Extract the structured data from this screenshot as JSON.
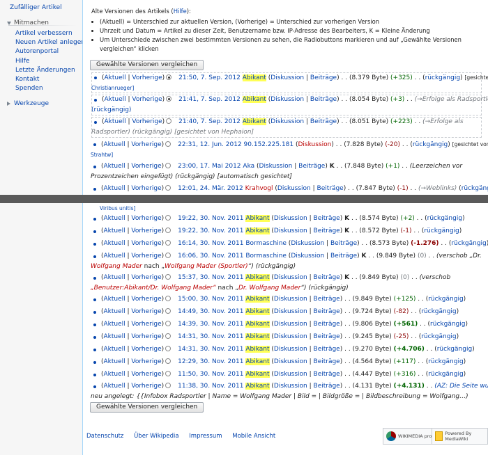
{
  "sidebar": {
    "top_link": "Zufälliger Artikel",
    "section1_title": "Mitmachen",
    "items": [
      "Artikel verbessern",
      "Neuen Artikel anlegen",
      "Autorenportal",
      "Hilfe",
      "Letzte Änderungen",
      "Kontakt",
      "Spenden"
    ],
    "section2_title": "Werkzeuge"
  },
  "notice": {
    "heading": "Alte Versionen des Artikels (",
    "help_link": "Hilfe",
    "heading_end": "):",
    "items": [
      "(Aktuell) = Unterschied zur aktuellen Version, (Vorherige) = Unterschied zur vorherigen Version",
      "Uhrzeit und Datum = Artikel zu dieser Zeit, Benutzername bzw. IP-Adresse des Bearbeiters, K = Kleine Änderung",
      "Um Unterschiede zwischen zwei bestimmten Versionen zu sehen, die Radiobuttons markieren und auf „Gewählte Versionen vergleichen“ klicken"
    ]
  },
  "compare_button": "Gewählte Versionen vergleichen",
  "history_top": [
    {
      "sel": true,
      "checked": true,
      "date": "21:50, 7. Sep. 2012",
      "user": "Abikant",
      "hl": true,
      "talk": true,
      "minor": false,
      "size": "(8.379 Byte)",
      "diff": "(+325)",
      "diff_style": "pos",
      "undo": "rückgängig",
      "note": "[gesichtet von",
      "line2": "Christianrueger]",
      "line2_kind": "link"
    },
    {
      "sel": true,
      "checked": true,
      "date": "21:41, 7. Sep. 2012",
      "user": "Abikant",
      "hl": true,
      "talk": true,
      "minor": false,
      "size": "(8.054 Byte)",
      "diff": "(+3)",
      "diff_style": "pos",
      "summary_arrow": "→Erfolge als Radsportler",
      "line2": "(rückgängig)",
      "line2_kind": "undo"
    },
    {
      "sel": true,
      "checked": false,
      "date": "21:40, 7. Sep. 2012",
      "user": "Abikant",
      "hl": true,
      "talk": true,
      "minor": false,
      "size": "(8.051 Byte)",
      "diff": "(+223)",
      "diff_style": "pos",
      "summary_arrow": "→Erfolge als",
      "line2": "Radsportler) (rückgängig) [gesichtet von Hephaion]",
      "line2_kind": "mixed1"
    },
    {
      "sel": false,
      "checked": false,
      "date": "22:31, 12. Jun. 2012",
      "user": "90.152.225.181",
      "hl": false,
      "talk_red": true,
      "minor": false,
      "size": "(7.828 Byte)",
      "diff": "(-20)",
      "diff_style": "neg",
      "undo": "rückgängig",
      "note": "[gesichtet von",
      "line2": "Strahtw]",
      "line2_kind": "plain"
    },
    {
      "sel": false,
      "checked": false,
      "date": "23:00, 17. Mai 2012",
      "user": "Aka",
      "hl": false,
      "talk": true,
      "minor": true,
      "size": "(7.848 Byte)",
      "diff": "(+1)",
      "diff_style": "pos",
      "summary": "(Leerzeichen vor",
      "line2": "Prozentzeichen eingefügt) (rückgängig) [automatisch gesichtet]",
      "line2_kind": "mixed2"
    },
    {
      "sel": false,
      "checked": false,
      "date": "12:01, 24. Mär. 2012",
      "user": "Krahvogl",
      "hl": false,
      "user_red": true,
      "talk": true,
      "minor": false,
      "size": "(7.847 Byte)",
      "diff": "(-1)",
      "diff_style": "neg",
      "summary_arrow": "→Weblinks",
      "undo": "rückgängig"
    }
  ],
  "partial_line": "Viribus unitis]",
  "history_bottom": [
    {
      "date": "19:22, 30. Nov. 2011",
      "user": "Abikant",
      "hl": true,
      "minor": true,
      "size": "(8.574 Byte)",
      "diff": "(+2)",
      "diff_style": "pos"
    },
    {
      "date": "19:22, 30. Nov. 2011",
      "user": "Abikant",
      "hl": true,
      "minor": true,
      "size": "(8.572 Byte)",
      "diff": "(-1)",
      "diff_style": "neg"
    },
    {
      "date": "16:14, 30. Nov. 2011",
      "user": "Bormaschine",
      "hl": false,
      "minor": false,
      "size": "(8.573 Byte)",
      "diff": "(-1.276)",
      "diff_style": "negb"
    },
    {
      "date": "16:06, 30. Nov. 2011",
      "user": "Bormaschine",
      "hl": false,
      "minor": true,
      "size": "(9.849 Byte)",
      "diff": "(0)",
      "diff_style": "grey",
      "move_a": "(verschob „Dr.",
      "move_line2_a": "Wolfgang Mader",
      "move_line2_b": " nach „",
      "move_line2_c": "Wolfgang Mader (Sportler)",
      "move_line2_d": "“) (rückgängig)"
    },
    {
      "date": "15:37, 30. Nov. 2011",
      "user": "Abikant",
      "hl": true,
      "minor": true,
      "size": "(9.849 Byte)",
      "diff": "(0)",
      "diff_style": "grey",
      "move_a": "(verschob",
      "move_line2_a": "„Benutzer:Abikant/Dr. Wolfgang Mader“",
      "move_line2_b": " nach „",
      "move_line2_c": "Dr. Wolfgang Mader",
      "move_line2_d": "“) (rückgängig)"
    },
    {
      "date": "15:00, 30. Nov. 2011",
      "user": "Abikant",
      "hl": true,
      "minor": false,
      "size": "(9.849 Byte)",
      "diff": "(+125)",
      "diff_style": "pos"
    },
    {
      "date": "14:49, 30. Nov. 2011",
      "user": "Abikant",
      "hl": true,
      "minor": false,
      "size": "(9.724 Byte)",
      "diff": "(-82)",
      "diff_style": "neg"
    },
    {
      "date": "14:39, 30. Nov. 2011",
      "user": "Abikant",
      "hl": true,
      "minor": false,
      "size": "(9.806 Byte)",
      "diff": "(+561)",
      "diff_style": "posb"
    },
    {
      "date": "14:31, 30. Nov. 2011",
      "user": "Abikant",
      "hl": true,
      "minor": false,
      "size": "(9.245 Byte)",
      "diff": "(-25)",
      "diff_style": "neg"
    },
    {
      "date": "14:31, 30. Nov. 2011",
      "user": "Abikant",
      "hl": true,
      "minor": false,
      "size": "(9.270 Byte)",
      "diff": "(+4.706)",
      "diff_style": "posb"
    },
    {
      "date": "12:29, 30. Nov. 2011",
      "user": "Abikant",
      "hl": true,
      "minor": false,
      "size": "(4.564 Byte)",
      "diff": "(+117)",
      "diff_style": "pos"
    },
    {
      "date": "11:50, 30. Nov. 2011",
      "user": "Abikant",
      "hl": true,
      "minor": false,
      "size": "(4.447 Byte)",
      "diff": "(+316)",
      "diff_style": "pos"
    },
    {
      "date": "11:38, 30. Nov. 2011",
      "user": "Abikant",
      "hl": true,
      "minor": false,
      "size": "(4.131 Byte)",
      "diff": "(+4.131)",
      "diff_style": "posb",
      "az": "(AZ: Die Seite wurde",
      "az_line2": "neu angelegt: {{Infobox Radsportler | Name = Wolfgang Mader | Bild = | Bildgröße = | Bildbeschreibung = Wolfgang…)"
    }
  ],
  "labels": {
    "aktuell": "Aktuell",
    "vorherige": "Vorherige",
    "diskussion": "Diskussion",
    "beitraege": "Beiträge",
    "minor": "K",
    "rueckgaengig": "rückgängig"
  },
  "footer": {
    "links": [
      "Datenschutz",
      "Über Wikipedia",
      "Impressum",
      "Mobile Ansicht"
    ],
    "badge1": "WIKIMEDIA project",
    "badge2": "Powered By MediaWiki"
  }
}
